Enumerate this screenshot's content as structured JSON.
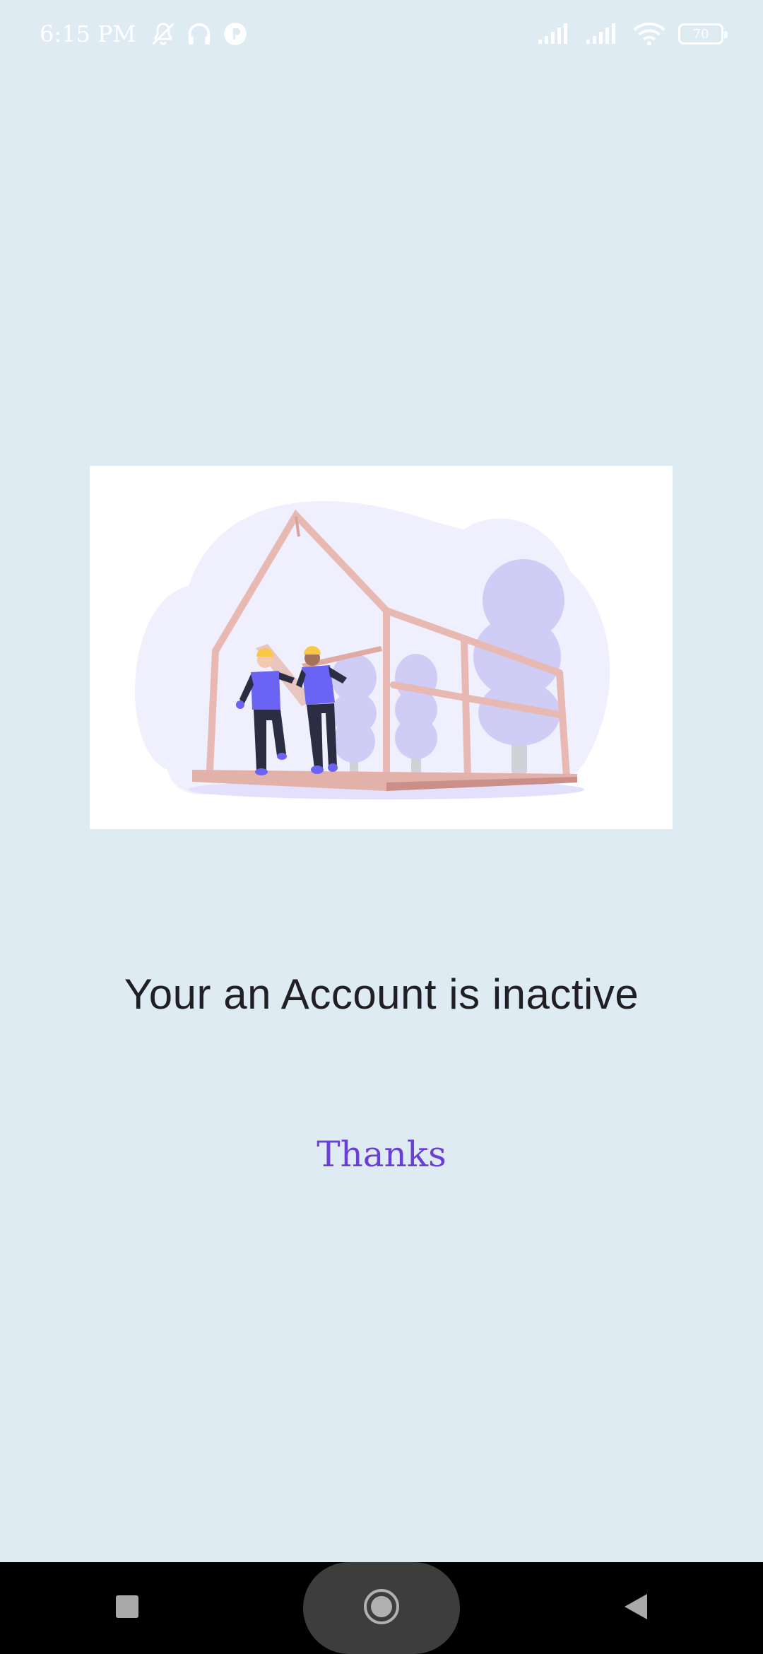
{
  "status_bar": {
    "time": "6:15 PM",
    "battery_level": "70",
    "icons": [
      "mute-bell-icon",
      "headphones-icon",
      "app-notification-icon",
      "signal-1-icon",
      "signal-2-icon",
      "wifi-icon",
      "battery-icon"
    ]
  },
  "main": {
    "illustration_name": "house-construction-illustration",
    "message": "Your an Account is inactive",
    "thanks_label": "Thanks"
  },
  "nav_bar": {
    "recents_icon": "square-icon",
    "home_icon": "circle-home-icon",
    "back_icon": "triangle-back-icon"
  },
  "colors": {
    "background": "#dfebf3",
    "accent": "#6a3fd6",
    "text": "#1f1f24",
    "nav_background": "#000000"
  }
}
